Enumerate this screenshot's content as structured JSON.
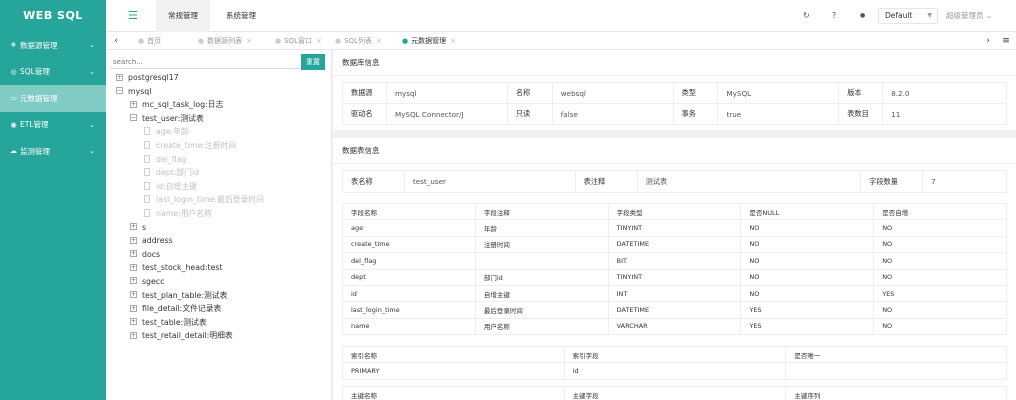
{
  "app": {
    "logo": "WEB SQL"
  },
  "sidebar": {
    "items": [
      {
        "icon": "❄",
        "label": "数据源管理",
        "chevron": "⌄"
      },
      {
        "icon": "◎",
        "label": "SQL管理",
        "chevron": "⌄"
      },
      {
        "icon": "▭",
        "label": "元数据管理",
        "chevron": ""
      },
      {
        "icon": "◉",
        "label": "ETL管理",
        "chevron": "⌄"
      },
      {
        "icon": "☁",
        "label": "监测管理",
        "chevron": "⌄"
      }
    ]
  },
  "header": {
    "menu_icon": "☰",
    "tabs": [
      "常规管理",
      "系统管理"
    ],
    "refresh_icon": "↻",
    "help_icon": "?",
    "theme_icon": "●",
    "datasource_select": "Default",
    "select_caret": "▼",
    "user": "超级管理员 ⌄"
  },
  "tabbar": {
    "left_arrow": "‹",
    "right_arrow": "›",
    "menu_icon": "≡",
    "tabs": [
      {
        "label": "首页",
        "close": ""
      },
      {
        "label": "数据源列表",
        "close": "×"
      },
      {
        "label": "SQL窗口",
        "close": "×"
      },
      {
        "label": "SQL列表",
        "close": "×"
      },
      {
        "label": "元数据管理",
        "close": "×"
      }
    ]
  },
  "tree": {
    "search_placeholder": "search...",
    "search_button": "重置",
    "nodes": [
      {
        "toggle": "+",
        "label": "postgresql17"
      },
      {
        "toggle": "−",
        "label": "mysql"
      },
      {
        "toggle": "+",
        "label": "mc_sql_task_log:日志"
      },
      {
        "toggle": "−",
        "label": "test_user:测试表"
      },
      {
        "toggle": "",
        "label": "age:年龄"
      },
      {
        "toggle": "",
        "label": "create_time:注册时间"
      },
      {
        "toggle": "",
        "label": "del_flag"
      },
      {
        "toggle": "",
        "label": "dept:部门id"
      },
      {
        "toggle": "",
        "label": "id:自增主键"
      },
      {
        "toggle": "",
        "label": "last_login_time:最后登录时间"
      },
      {
        "toggle": "",
        "label": "name:用户名称"
      },
      {
        "toggle": "+",
        "label": "s"
      },
      {
        "toggle": "+",
        "label": "address"
      },
      {
        "toggle": "+",
        "label": "docs"
      },
      {
        "toggle": "+",
        "label": "test_stock_head:test"
      },
      {
        "toggle": "+",
        "label": "sgecc"
      },
      {
        "toggle": "+",
        "label": "test_plan_table:测试表"
      },
      {
        "toggle": "+",
        "label": "file_detail:文件记录表"
      },
      {
        "toggle": "+",
        "label": "test_table:测试表"
      },
      {
        "toggle": "+",
        "label": "test_retail_detail:明细表"
      }
    ]
  },
  "db_info": {
    "title": "数据库信息",
    "rows": [
      [
        "数据源",
        "mysql",
        "名称",
        "websql",
        "类型",
        "MySQL",
        "版本",
        "8.2.0"
      ],
      [
        "驱动名",
        "MySQL Connector/J",
        "只读",
        "false",
        "事务",
        "true",
        "表数目",
        "11"
      ]
    ]
  },
  "table_info": {
    "title": "数据表信息",
    "summary": [
      "表名称",
      "test_user",
      "表注释",
      "测试表",
      "字段数量",
      "7"
    ],
    "columns_header": [
      "字段名称",
      "字段注释",
      "字段类型",
      "是否NULL",
      "是否自增"
    ],
    "columns": [
      [
        "age",
        "年龄",
        "TINYINT",
        "NO",
        "NO"
      ],
      [
        "create_time",
        "注册时间",
        "DATETIME",
        "NO",
        "NO"
      ],
      [
        "del_flag",
        "",
        "BIT",
        "NO",
        "NO"
      ],
      [
        "dept",
        "部门id",
        "TINYINT",
        "NO",
        "NO"
      ],
      [
        "id",
        "自增主键",
        "INT",
        "NO",
        "YES"
      ],
      [
        "last_login_time",
        "最后登录时间",
        "DATETIME",
        "YES",
        "NO"
      ],
      [
        "name",
        "用户名称",
        "VARCHAR",
        "YES",
        "NO"
      ]
    ],
    "index_header": [
      "索引名称",
      "索引字段",
      "是否唯一"
    ],
    "indexes": [
      [
        "PRIMARY",
        "id",
        ""
      ]
    ],
    "pk_header": [
      "主键名称",
      "主键字段",
      "主键序列"
    ]
  }
}
